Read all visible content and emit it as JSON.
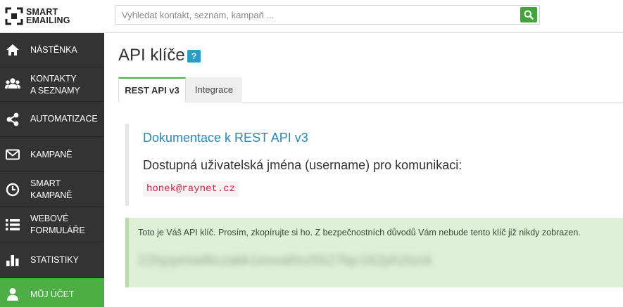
{
  "brand": {
    "line1": "SMART",
    "line2": "EMAILING"
  },
  "search": {
    "placeholder": "Vyhledat kontakt, seznam, kampaň ..."
  },
  "sidebar": {
    "items": [
      {
        "label": "NÁSTĚNKA",
        "icon": "home-icon",
        "active": false
      },
      {
        "label": "KONTAKTY\nA SEZNAMY",
        "icon": "users-icon",
        "active": false
      },
      {
        "label": "AUTOMATIZACE",
        "icon": "share-icon",
        "active": false
      },
      {
        "label": "KAMPANĚ",
        "icon": "envelope-icon",
        "active": false
      },
      {
        "label": "SMART\nKAMPANĚ",
        "icon": "clock-icon",
        "active": false
      },
      {
        "label": "WEBOVÉ\nFORMULÁŘE",
        "icon": "list-icon",
        "active": false
      },
      {
        "label": "STATISTIKY",
        "icon": "bar-chart-icon",
        "active": false
      },
      {
        "label": "MŮJ ÚČET",
        "icon": "user-icon",
        "active": true
      }
    ]
  },
  "page": {
    "title": "API klíče",
    "help": "?",
    "tabs": [
      {
        "label": "REST API v3",
        "active": true
      },
      {
        "label": "Integrace",
        "active": false
      }
    ],
    "doc_link": "Dokumentace k REST API v3",
    "usernames_label": "Dostupná uživatelská jména (username) pro komunikaci:",
    "username": "honek@raynet.cz",
    "alert_text": "Toto je Váš API klíč. Prosím, zkopírujte si ho. Z bezpečnostních důvodů Vám nebude tento klíč již nikdy zobrazen.",
    "api_key": "22hjzpmiaf6czakk1exxathrz5527lqc162ph2tzck"
  },
  "colors": {
    "sidebar_bg": "#333333",
    "active": "#4cae44",
    "link": "#2a87b3",
    "alert_bg": "#dff0d8",
    "code_red": "#c7254e"
  }
}
